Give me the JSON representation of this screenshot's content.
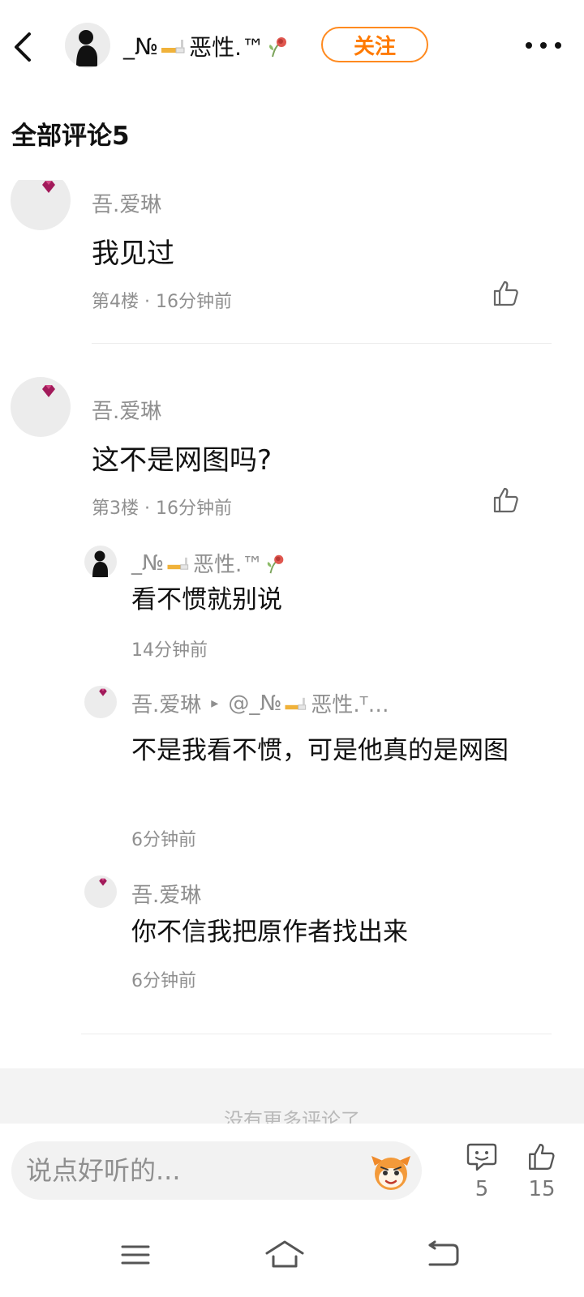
{
  "header": {
    "author_name": "_№",
    "author_suffix": "恶性.™",
    "follow_label": "关注"
  },
  "section_title": "全部评论5",
  "comments": [
    {
      "user": "吾.爱琳",
      "text": "我见过",
      "meta": "第4楼 · 16分钟前"
    },
    {
      "user": "吾.爱琳",
      "text": "这不是网图吗?",
      "meta": "第3楼 · 16分钟前",
      "replies": [
        {
          "user_prefix": "_№",
          "user_suffix": "恶性.™",
          "text": "看不惯就别说",
          "time": "14分钟前"
        },
        {
          "user": "吾.爱琳",
          "reply_arrow": "▸",
          "target_prefix": "@_№",
          "target_suffix": "恶性.ᵀ…",
          "text": "不是我看不惯，可是他真的是网图",
          "time": "6分钟前"
        },
        {
          "user": "吾.爱琳",
          "text": "你不信我把原作者找出来",
          "time": "6分钟前"
        }
      ]
    }
  ],
  "no_more_text": "没有更多评论了",
  "input": {
    "placeholder": "说点好听的..."
  },
  "stats": {
    "comments_count": "5",
    "likes_count": "15"
  },
  "icons": {
    "back": "chevron-left-icon",
    "more": "more-icon",
    "like": "thumbs-up-icon",
    "comment": "comment-icon",
    "emoji": "emoji-face-icon",
    "nav_menu": "menu-icon",
    "nav_home": "home-icon",
    "nav_back": "nav-back-icon"
  },
  "colors": {
    "accent": "#ff7a00",
    "secondary_text": "#8f8f8f",
    "primary_text": "#111111",
    "input_bg": "#f2f2f2"
  }
}
